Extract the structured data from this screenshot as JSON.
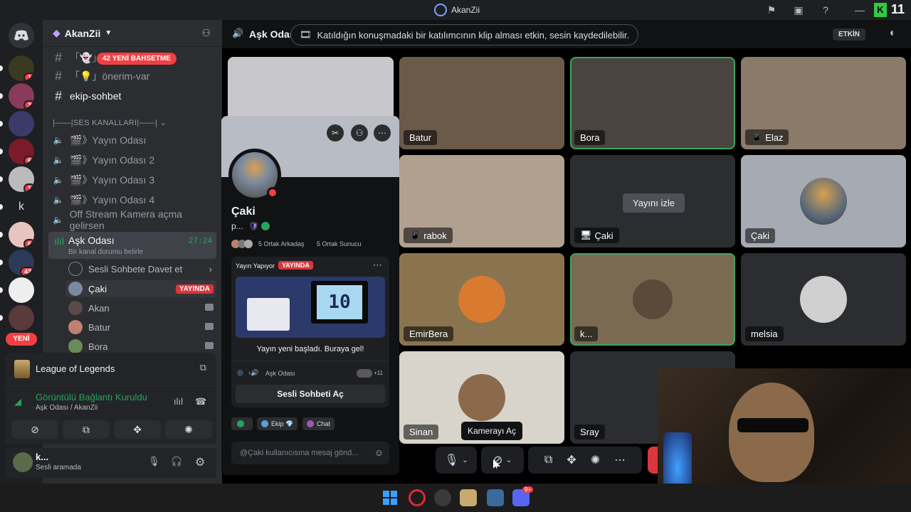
{
  "titlebar": {
    "title": "AkanZii",
    "right_badge": "11"
  },
  "rail": {
    "servers": [
      {
        "name": "server-1",
        "badge": "1",
        "color": "#3a3a20"
      },
      {
        "name": "server-2",
        "badge": "3",
        "color": "#8a3a5a"
      },
      {
        "name": "server-3",
        "badge": "",
        "color": "#3b3a6b"
      },
      {
        "name": "server-4",
        "badge": "6",
        "color": "#7a1a2a"
      },
      {
        "name": "server-5",
        "badge": "1",
        "color": "#bbbbbb"
      },
      {
        "name": "server-6",
        "badge": "",
        "color": "#1e1f22",
        "letter": "k"
      },
      {
        "name": "server-7",
        "badge": "6",
        "color": "#e8c4c0"
      },
      {
        "name": "server-8",
        "badge": "42",
        "color": "#2c3a5a"
      },
      {
        "name": "server-9",
        "badge": "",
        "color": "#eeeeee"
      },
      {
        "name": "server-10",
        "badge": "",
        "color": "#5a3a3a"
      }
    ],
    "new_label": "YENİ"
  },
  "sidebar": {
    "server_name": "AkanZii",
    "mention_banner": "42 YENİ BAHSETME",
    "text_channels": [
      {
        "label": "「💡」önerim-var",
        "bright": false
      },
      {
        "label": "ekip-sohbet",
        "bright": true
      }
    ],
    "category": "|——|SES KANALLARI|——|",
    "voice_channels": [
      {
        "label": "🎬》Yayın Odası"
      },
      {
        "label": "🎬》Yayın Odası 2"
      },
      {
        "label": "🎬》Yayın Odası 3"
      },
      {
        "label": "🎬》Yayın Odası 4"
      },
      {
        "label": "Off Stream Kamera açma gelirsen"
      }
    ],
    "active_channel": {
      "label": "Aşk Odası",
      "timer": "27:24",
      "status": "Bir kanal durumu belirle"
    },
    "invite_label": "Sesli Sohbete Davet et",
    "voice_users": [
      {
        "name": "Çaki",
        "live": "YAYINDA",
        "color": "#7a8aa0"
      },
      {
        "name": "Akan",
        "live": "",
        "color": "#5a4a4a"
      },
      {
        "name": "Batur",
        "live": "",
        "color": "#c08070"
      },
      {
        "name": "Bora",
        "live": "",
        "color": "#6a8a5a"
      }
    ]
  },
  "activity": {
    "game": "League of Legends"
  },
  "rtc": {
    "status": "Görüntülü Bağlantı Kuruldu",
    "channel": "Aşk Odası / AkanZii"
  },
  "user": {
    "name": "k...",
    "status": "Sesli aramada"
  },
  "main": {
    "channel_name": "Aşk Odası",
    "notice": "Katıldığın konuşmadaki bir katılımcının klip alması etkin, sesin kaydedilebilir.",
    "event_badge": "ETKİN"
  },
  "tiles": [
    {
      "label": "Batur",
      "icon": "",
      "bg": "#6a5a48"
    },
    {
      "label": "Bora",
      "icon": "",
      "bg": "#4a4440"
    },
    {
      "label": "Elaz",
      "icon": "📱",
      "bg": "#8a7a6a"
    },
    {
      "label": "rabok",
      "icon": "📱",
      "bg": "#b0a090"
    },
    {
      "label": "Çaki",
      "icon": "🖥",
      "bg": "#2b2d31",
      "watch": "Yayını izle"
    },
    {
      "label": "Çaki",
      "icon": "",
      "bg": "#a6aab3"
    },
    {
      "label": "EmirBera",
      "icon": "",
      "bg": "#8a7450"
    },
    {
      "label": "k...",
      "icon": "",
      "bg": "#7a6a52"
    },
    {
      "label": "melsia",
      "icon": "",
      "bg": "#2b2d31"
    },
    {
      "label": "Sinan",
      "icon": "",
      "bg": "#d8d4cc"
    },
    {
      "label": "Sray",
      "icon": "",
      "bg": "#2b2d31"
    }
  ],
  "popout": {
    "name": "Çaki",
    "tag": "p...",
    "mutuals": "5 Ortak Arkadaş",
    "servers": "5 Ortak Sunucu",
    "activity_title": "Yayın Yapıyor",
    "live": "YAYINDA",
    "stream_msg": "Yayın yeni başladı. Buraya gel!",
    "channel": "Aşk Odası",
    "extra": "+11",
    "join_btn": "Sesli Sohbeti Aç",
    "roles": [
      "Ekip",
      "Chat"
    ],
    "input_placeholder": "@Çaki kullanıcısına mesaj gönd..."
  },
  "tooltip": "Kamerayı Aç",
  "taskbar": {
    "discord_badge": "9+"
  }
}
